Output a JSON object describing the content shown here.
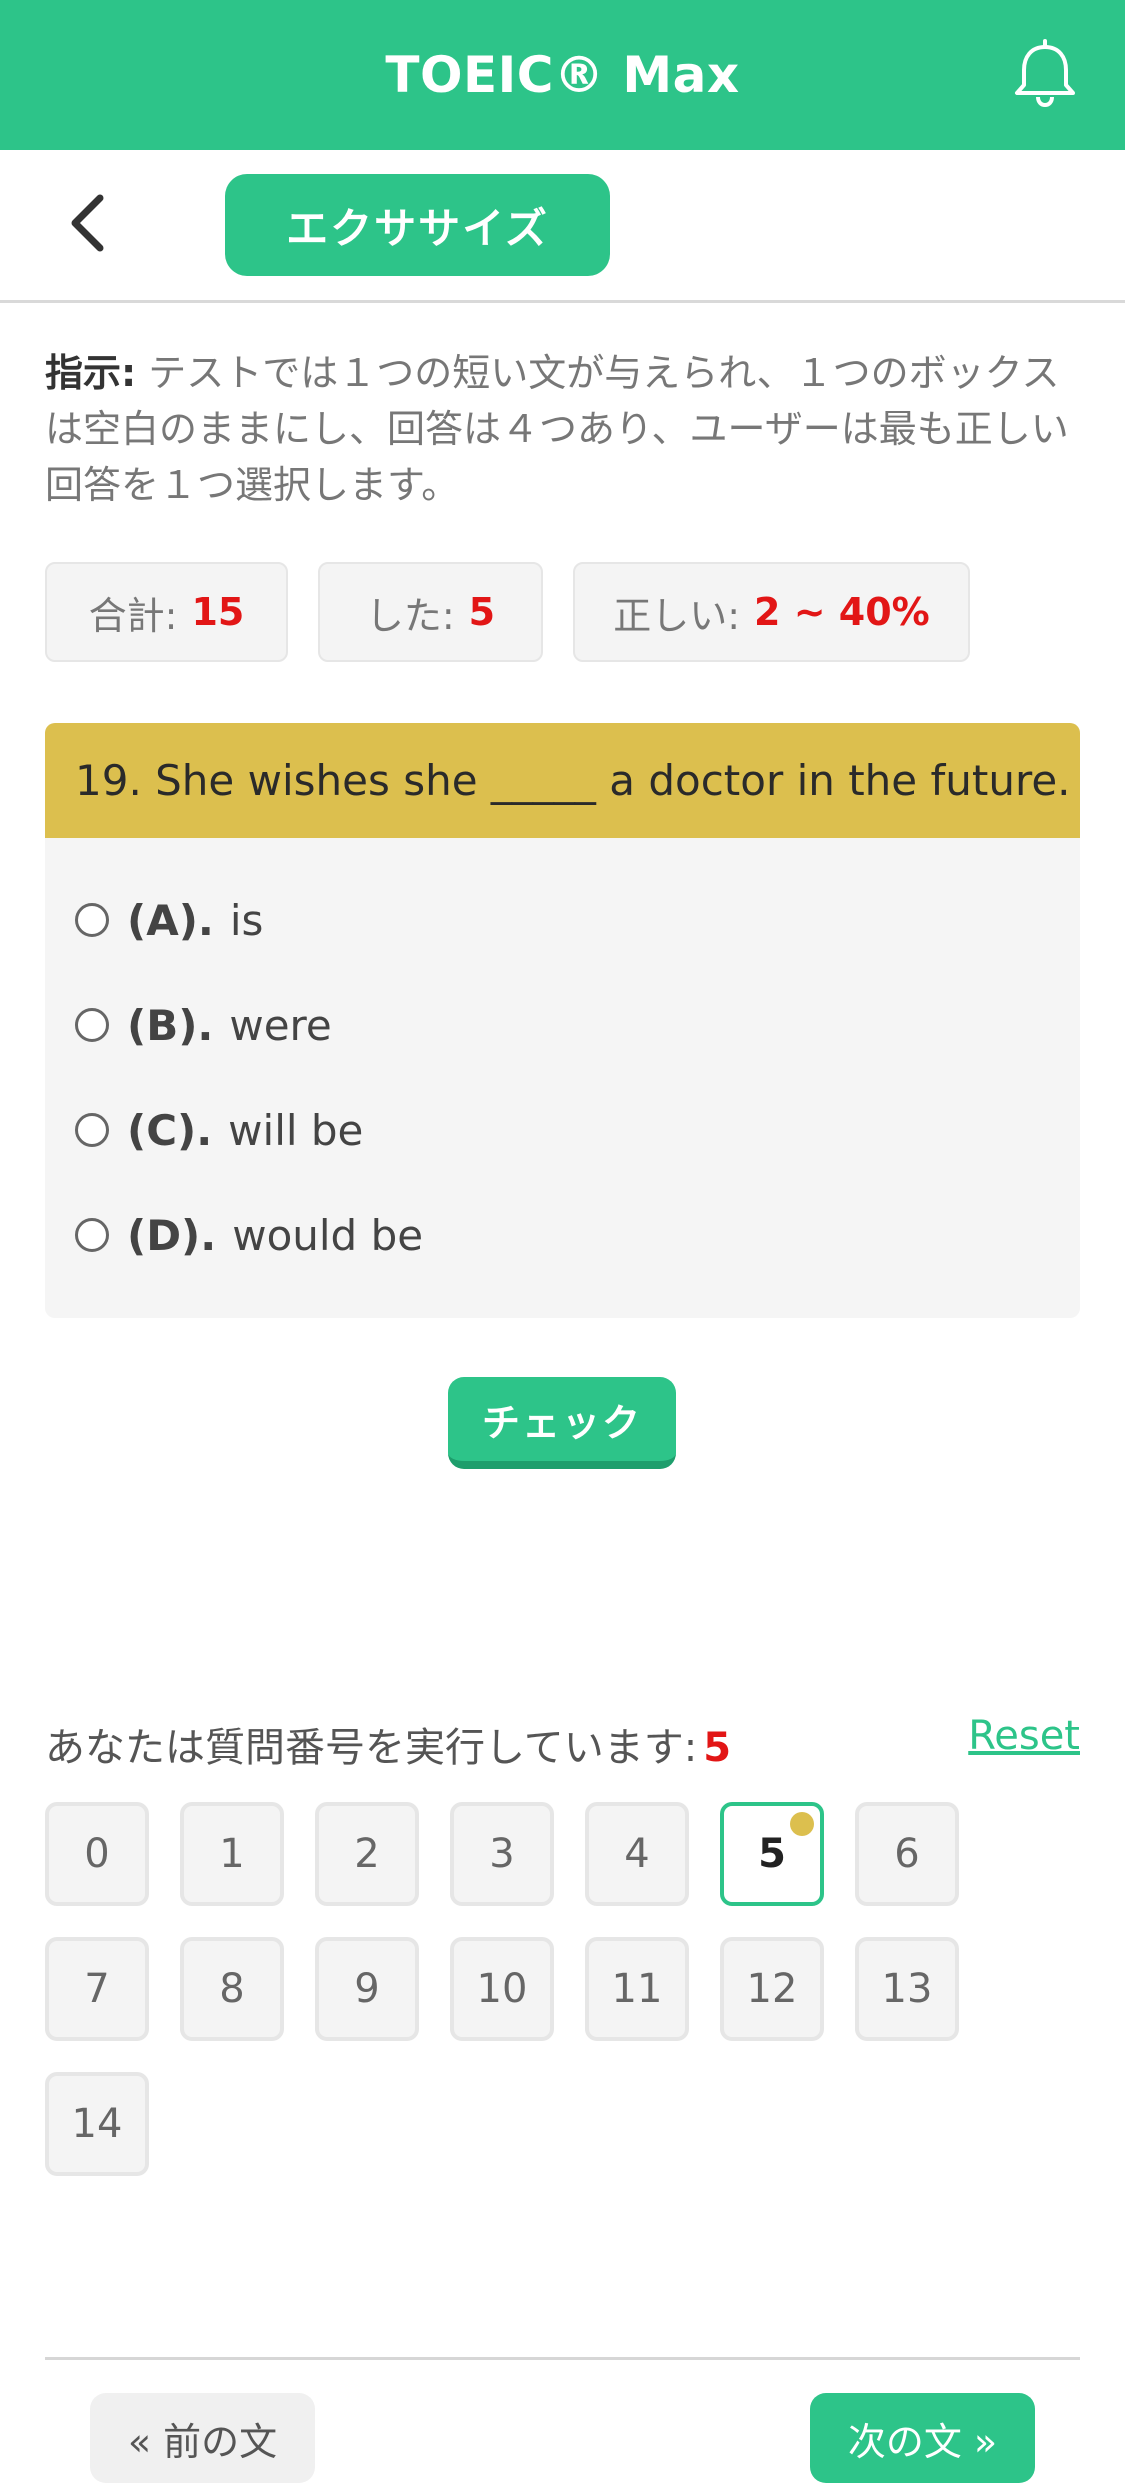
{
  "app": {
    "title": "TOEIC® Max",
    "theme_color": "#2dc489"
  },
  "subheader": {
    "exercise_label": "エクササイズ"
  },
  "instructions": {
    "label": "指示:",
    "text": " テストでは１つの短い文が与えられ、１つのボックスは空白のままにし、回答は４つあり、ユーザーは最も正しい回答を１つ選択します。"
  },
  "stats": {
    "total_label": "合計:",
    "total_value": "15",
    "done_label": "した:",
    "done_value": "5",
    "correct_label": "正しい:",
    "correct_value": "2 ~ 40%"
  },
  "question": {
    "text": "19. She wishes she _____ a doctor in the future.",
    "header_color": "#dcbf4e",
    "options": [
      {
        "letter": "(A).",
        "text": "is"
      },
      {
        "letter": "(B).",
        "text": "were"
      },
      {
        "letter": "(C).",
        "text": "will be"
      },
      {
        "letter": "(D).",
        "text": "would be"
      }
    ]
  },
  "check_label": "チェック",
  "progress": {
    "label": "あなたは質問番号を実行しています:",
    "current": "5",
    "reset_label": "Reset",
    "numbers": [
      "0",
      "1",
      "2",
      "3",
      "4",
      "5",
      "6",
      "7",
      "8",
      "9",
      "10",
      "11",
      "12",
      "13",
      "14"
    ]
  },
  "nav": {
    "prev_label": "« 前の文",
    "next_label": "次の文 »"
  }
}
